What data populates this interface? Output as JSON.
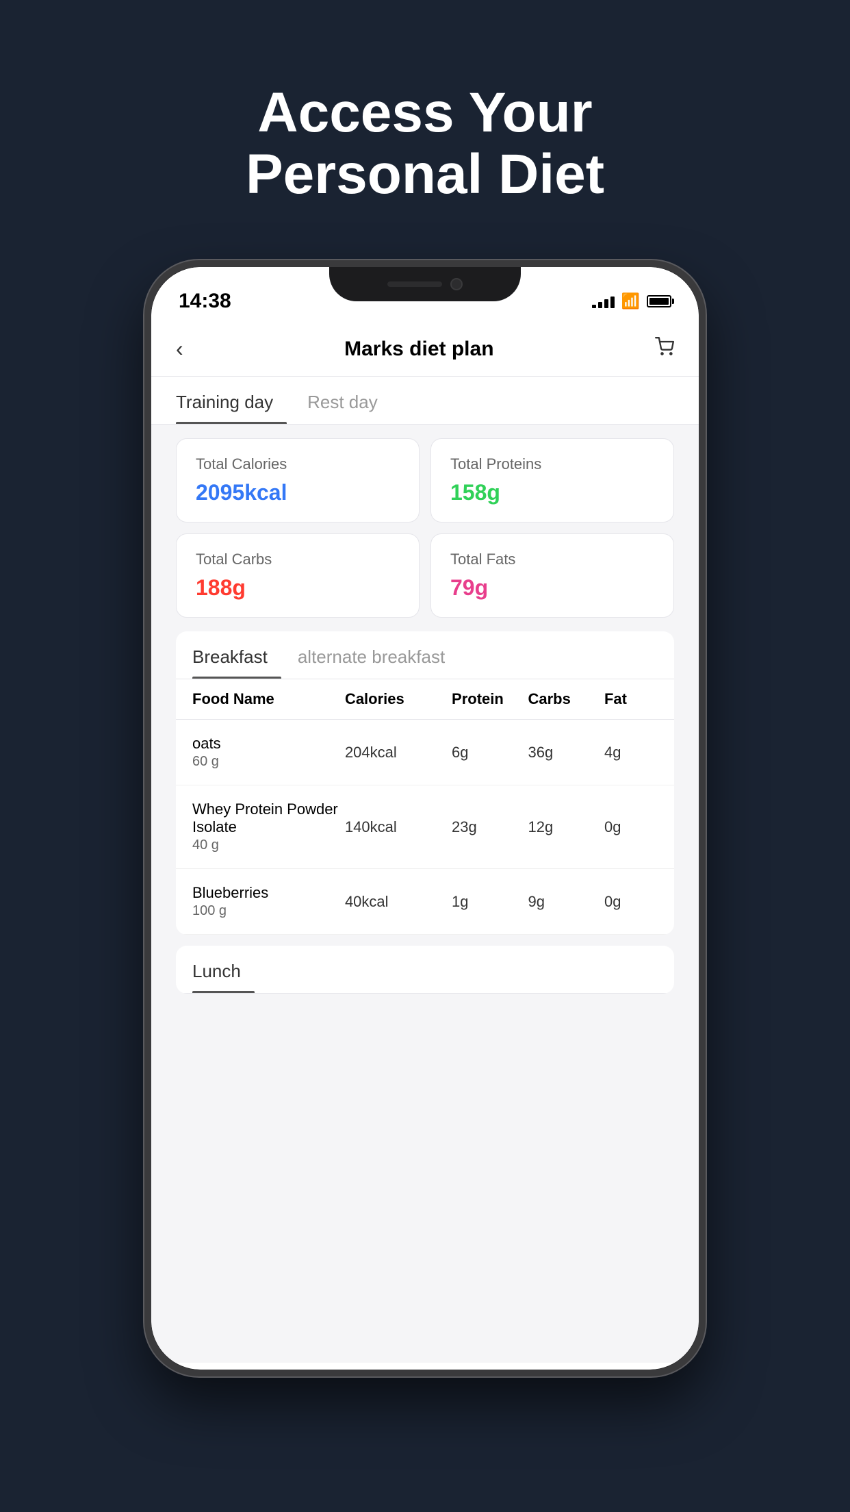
{
  "page": {
    "headline_line1": "Access Your",
    "headline_line2": "Personal Diet",
    "background_color": "#1a2332"
  },
  "status_bar": {
    "time": "14:38",
    "signal_bars": [
      5,
      9,
      13,
      17
    ],
    "wifi": "wifi",
    "battery": "battery"
  },
  "nav": {
    "back_label": "‹",
    "title": "Marks diet plan",
    "cart_label": "🛒"
  },
  "day_tabs": [
    {
      "label": "Training day",
      "active": true
    },
    {
      "label": "Rest day",
      "active": false
    }
  ],
  "stats": [
    {
      "label": "Total Calories",
      "value": "2095kcal",
      "color_class": "blue"
    },
    {
      "label": "Total Proteins",
      "value": "158g",
      "color_class": "green"
    },
    {
      "label": "Total Carbs",
      "value": "188g",
      "color_class": "red"
    },
    {
      "label": "Total Fats",
      "value": "79g",
      "color_class": "pink"
    }
  ],
  "meal_tabs": [
    {
      "label": "Breakfast",
      "active": true
    },
    {
      "label": "alternate breakfast",
      "active": false
    }
  ],
  "food_table": {
    "headers": [
      "Food Name",
      "Calories",
      "Protein",
      "Carbs",
      "Fat"
    ],
    "rows": [
      {
        "name": "oats",
        "weight": "60 g",
        "calories": "204kcal",
        "protein": "6g",
        "carbs": "36g",
        "fat": "4g"
      },
      {
        "name": "Whey Protein Powder Isolate",
        "weight": "40 g",
        "calories": "140kcal",
        "protein": "23g",
        "carbs": "12g",
        "fat": "0g"
      },
      {
        "name": "Blueberries",
        "weight": "100 g",
        "calories": "40kcal",
        "protein": "1g",
        "carbs": "9g",
        "fat": "0g"
      }
    ]
  },
  "lunch_tabs": [
    {
      "label": "Lunch",
      "active": true
    }
  ]
}
